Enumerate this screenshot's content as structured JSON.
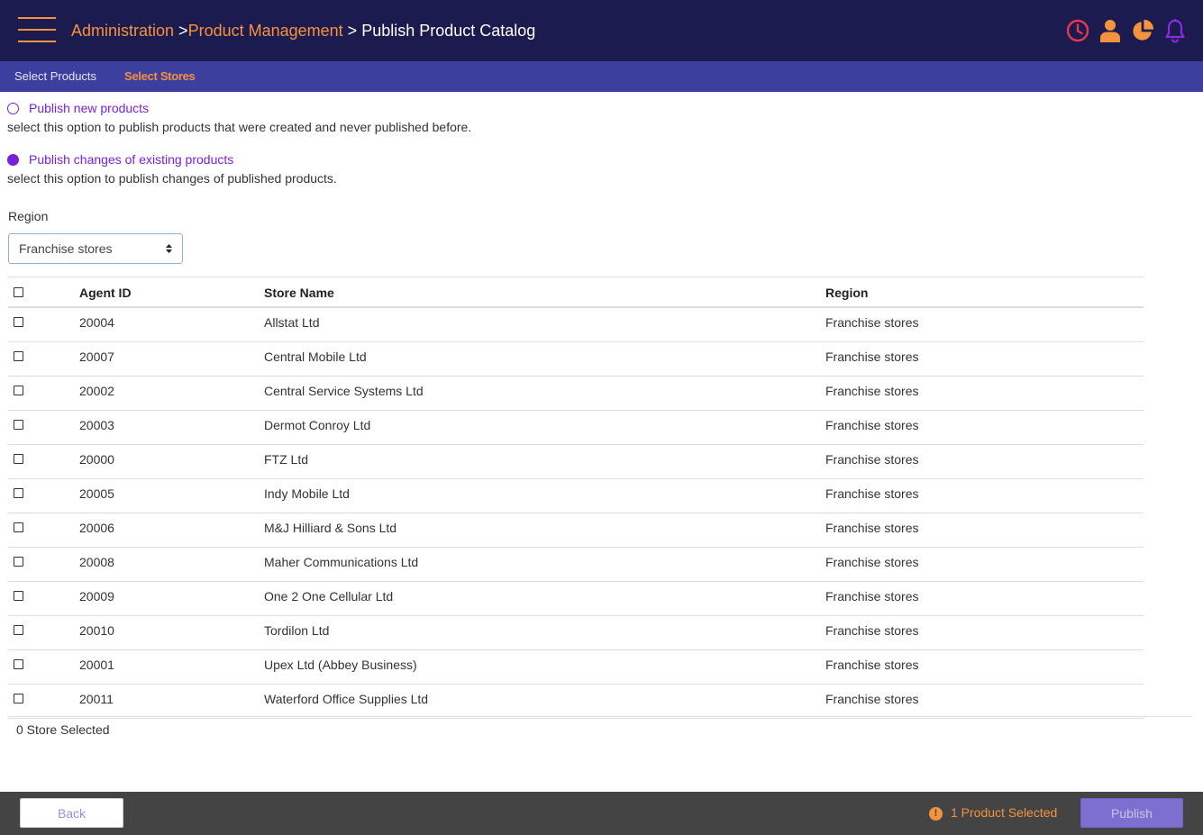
{
  "header": {
    "breadcrumb": {
      "item1": "Administration",
      "sep1": " >",
      "item2": "Product Management",
      "sep2": " > ",
      "current": "Publish Product Catalog"
    },
    "icons": [
      "clock-icon",
      "user-icon",
      "pie-chart-icon",
      "bell-icon"
    ],
    "colors": {
      "background": "#1b1b4f",
      "accent": "#f5923e",
      "clock": "#e8384f",
      "bell": "#8a2be2"
    }
  },
  "tabs": {
    "select_products": "Select Products",
    "select_stores": "Select Stores",
    "active": "Select Stores"
  },
  "options": {
    "new_products": {
      "label": "Publish new products",
      "description": "select this option to publish products that were created and never published before.",
      "selected": false
    },
    "changes": {
      "label": "Publish changes of existing products",
      "description": "select this option to publish changes of published products.",
      "selected": true
    }
  },
  "region_filter": {
    "label": "Region",
    "value": "Franchise stores"
  },
  "table": {
    "columns": {
      "agent_id": "Agent ID",
      "store_name": "Store Name",
      "region": "Region"
    },
    "rows": [
      {
        "agent_id": "20004",
        "store_name": "Allstat Ltd",
        "region": "Franchise stores"
      },
      {
        "agent_id": "20007",
        "store_name": "Central Mobile Ltd",
        "region": "Franchise stores"
      },
      {
        "agent_id": "20002",
        "store_name": "Central Service Systems Ltd",
        "region": "Franchise stores"
      },
      {
        "agent_id": "20003",
        "store_name": "Dermot Conroy Ltd",
        "region": "Franchise stores"
      },
      {
        "agent_id": "20000",
        "store_name": "FTZ Ltd",
        "region": "Franchise stores"
      },
      {
        "agent_id": "20005",
        "store_name": "Indy Mobile Ltd",
        "region": "Franchise stores"
      },
      {
        "agent_id": "20006",
        "store_name": "M&J Hilliard & Sons Ltd",
        "region": "Franchise stores"
      },
      {
        "agent_id": "20008",
        "store_name": "Maher Communications Ltd",
        "region": "Franchise stores"
      },
      {
        "agent_id": "20009",
        "store_name": "One 2 One Cellular Ltd",
        "region": "Franchise stores"
      },
      {
        "agent_id": "20010",
        "store_name": "Tordilon Ltd",
        "region": "Franchise stores"
      },
      {
        "agent_id": "20001",
        "store_name": "Upex Ltd (Abbey Business)",
        "region": "Franchise stores"
      },
      {
        "agent_id": "20011",
        "store_name": "Waterford Office Supplies Ltd",
        "region": "Franchise stores"
      }
    ],
    "selected_count_text": "0 Store Selected"
  },
  "footer": {
    "back_label": "Back",
    "warning_symbol": "!",
    "selected_products_text": "1 Product Selected",
    "publish_label": "Publish",
    "colors": {
      "background": "#444444",
      "publish_button": "#7c6fcf",
      "warning": "#f5923e"
    }
  }
}
